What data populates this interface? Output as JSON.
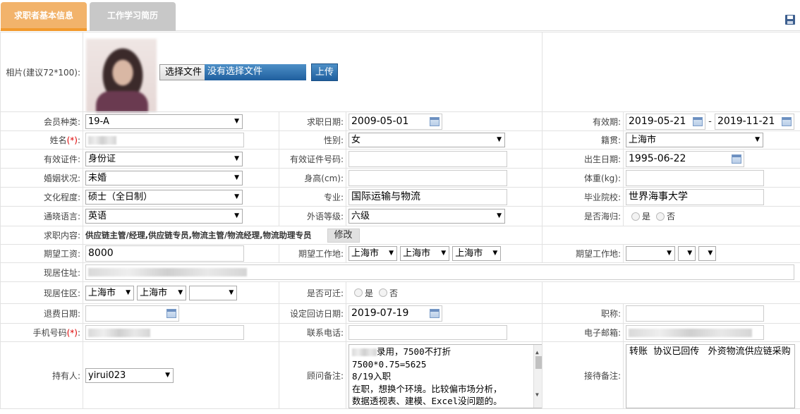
{
  "tabs": [
    {
      "label": "求职者基本信息"
    },
    {
      "label": "工作学习简历"
    }
  ],
  "icons": {
    "save": "save-icon",
    "calendar": "calendar-icon",
    "dropdown": "chevron-down-icon"
  },
  "colors": {
    "tab_active": "#f2b36b",
    "tab_inactive": "#c8c8c8",
    "upload_button": "#2b6fad",
    "required_mark": "#dd0000"
  },
  "photo": {
    "label": "相片(建议72*100):",
    "choose_file_label": "选择文件",
    "file_status": "没有选择文件",
    "upload_label": "上传"
  },
  "fields": {
    "member_type": {
      "label": "会员种类:",
      "value": "19-A"
    },
    "job_date": {
      "label": "求职日期:",
      "value": "2009-05-01"
    },
    "valid_period": {
      "label": "有效期:",
      "start": "2019-05-21",
      "separator": "-",
      "end": "2019-11-21"
    },
    "name": {
      "label": "姓名",
      "required": "(*)",
      "colon": ":"
    },
    "gender": {
      "label": "性别:",
      "value": "女"
    },
    "native_place": {
      "label": "籍贯:",
      "value": "上海市"
    },
    "id_type": {
      "label": "有效证件:",
      "value": "身份证"
    },
    "id_number": {
      "label": "有效证件号码:",
      "value": ""
    },
    "birth_date": {
      "label": "出生日期:",
      "value": "1995-06-22"
    },
    "marital": {
      "label": "婚姻状况:",
      "value": "未婚"
    },
    "height": {
      "label": "身高(cm):",
      "value": ""
    },
    "weight": {
      "label": "体重(kg):",
      "value": ""
    },
    "education": {
      "label": "文化程度:",
      "value": "硕士（全日制）"
    },
    "major": {
      "label": "专业:",
      "value": "国际运输与物流"
    },
    "school": {
      "label": "毕业院校:",
      "value": "世界海事大学"
    },
    "language": {
      "label": "通晓语言:",
      "value": "英语"
    },
    "lang_level": {
      "label": "外语等级:",
      "value": "六级"
    },
    "returnee": {
      "label": "是否海归:",
      "yes": "是",
      "no": "否"
    },
    "job_content": {
      "label": "求职内容:",
      "value": "供应链主管/经理,供应链专员,物流主管/物流经理,物流助理专员",
      "modify_label": "修改"
    },
    "expected_salary": {
      "label": "期望工资:",
      "value": "8000"
    },
    "expected_location1": {
      "label": "期望工作地:",
      "province": "上海市",
      "city": "上海市",
      "district": "上海市"
    },
    "expected_location2": {
      "label": "期望工作地:",
      "province": "",
      "city": "",
      "district": ""
    },
    "current_address": {
      "label": "现居住址:"
    },
    "current_area": {
      "label": "现居住区:",
      "province": "上海市",
      "city": "上海市",
      "district": ""
    },
    "relocate": {
      "label": "是否可迁:",
      "yes": "是",
      "no": "否"
    },
    "refund_date": {
      "label": "退费日期:",
      "value": ""
    },
    "revisit_date": {
      "label": "设定回访日期:",
      "value": "2019-07-19"
    },
    "title": {
      "label": "职称:",
      "value": ""
    },
    "mobile": {
      "label": "手机号码",
      "required": "(*)",
      "colon": ":"
    },
    "phone": {
      "label": "联系电话:",
      "value": ""
    },
    "email": {
      "label": "电子邮箱:"
    },
    "holder": {
      "label": "持有人:",
      "value": "yirui023"
    },
    "consultant_note": {
      "label": "顾问备注:",
      "line1": "录用，7500不打折",
      "line2": "7500*0.75=5625",
      "line3": "8/19入职",
      "line4": "在职，想换个环境。比较偏市场分析，",
      "line5": "数据透视表、建模、Excel没问题的。"
    },
    "reception_note": {
      "label": "接待备注:",
      "value": "转账  协议已回传   外资物流供应链采购"
    }
  }
}
